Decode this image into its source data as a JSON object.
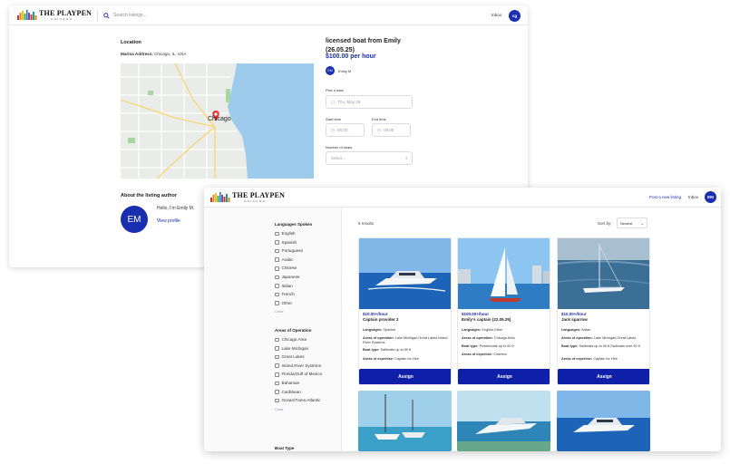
{
  "app": {
    "brand": "THE PLAYPEN",
    "brand_sub": "CHICAGO"
  },
  "back": {
    "search_placeholder": "Search listings...",
    "inbox": "Inbox",
    "avatar": "cg",
    "location_title": "Location",
    "marina_label": "Marina Address:",
    "marina_value": "Chicago, IL, USA",
    "map_city": "Chicago",
    "about_title": "About the listing author",
    "author_initials": "EM",
    "author_hello": "Hello, I'm Emily M.",
    "view_profile": "View profile",
    "listing_title": "licensed boat from Emily (26.05.25)",
    "price": "$100.00 per hour",
    "owner_initials": "EM",
    "owner_name": "Emily M",
    "pick_date_label": "Pick a date",
    "date_value": "Thu, May 29",
    "start_label": "Start time",
    "start_value": "08:00",
    "end_label": "End time",
    "end_value": "08:00",
    "seats_label": "Number of seats",
    "seats_placeholder": "Select..."
  },
  "front": {
    "post_listing": "Post a new listing",
    "inbox": "Inbox",
    "avatar": "EM",
    "results": "6 results",
    "sort_label": "Sort by:",
    "sort_value": "Newest",
    "filters": {
      "languages": {
        "title": "Languages Spoken",
        "options": [
          "English",
          "Spanish",
          "Portuguese",
          "Arabic",
          "Chinese",
          "Japanese",
          "Italian",
          "French",
          "Other"
        ],
        "clear": "Clear"
      },
      "areas": {
        "title": "Areas of Operation",
        "options": [
          "Chicago Area",
          "Lake Michigan",
          "Great Lakes",
          "Inland River Systems",
          "Florida/Gulf of Mexico",
          "Bahamas",
          "Caribbean",
          "Ocean/Trans-Atlantic"
        ],
        "clear": "Clear"
      },
      "boat_type": {
        "title": "Boat Type"
      }
    },
    "cards": [
      {
        "price": "$10.00+/hour",
        "name": "Captain provider 2",
        "languages_label": "Languages:",
        "languages": "Spanish",
        "areas_label": "Areas of operation:",
        "areas": "Lake Michigan,Great Lakes,Inland River Systems",
        "boat_label": "Boat type:",
        "boat": "Sailboats up to 50 ft",
        "expertise_label": "Areas of expertise:",
        "expertise": "Captain for Hire",
        "assign": "Assign"
      },
      {
        "price": "$100.00+/hour",
        "name": "Emily's captain (22.05.25)",
        "languages_label": "Languages:",
        "languages": "English,Other",
        "areas_label": "Areas of operation:",
        "areas": "Chicago Area",
        "boat_label": "Boat type:",
        "boat": "Powerboats up to 50 ft",
        "expertise_label": "Areas of expertise:",
        "expertise": "Charters",
        "assign": "Assign"
      },
      {
        "price": "$10.00+/hour",
        "name": "Jack sparrow",
        "languages_label": "Languages:",
        "languages": "Italian",
        "areas_label": "Areas of operation:",
        "areas": "Lake Michigan,Great Lakes",
        "boat_label": "Boat type:",
        "boat": "Sailboats up to 50 ft,Sailboats over 50 ft",
        "expertise_label": "Areas of expertise:",
        "expertise": "Captain for Hire",
        "assign": "Assign"
      }
    ]
  },
  "colors": {
    "brand_blue": "#1a2fb0",
    "button_blue": "#0e1fa8"
  }
}
